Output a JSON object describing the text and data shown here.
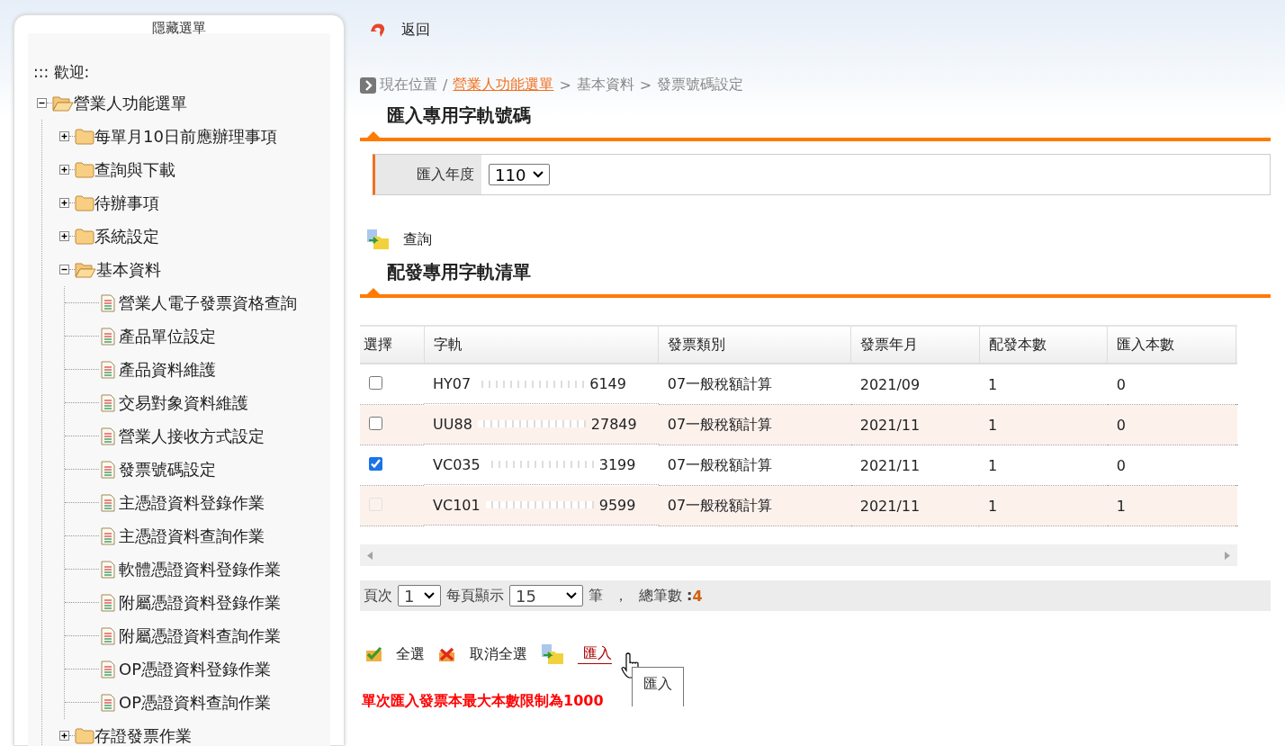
{
  "sidebar": {
    "title": "隱藏選單",
    "welcome": "::: 歡迎:",
    "tree": [
      {
        "kind": "folder",
        "label": "營業人功能選單",
        "expanded": true,
        "children": [
          {
            "kind": "folder",
            "label": "每單月10日前應辦理事項",
            "expanded": false
          },
          {
            "kind": "folder",
            "label": "查詢與下載",
            "expanded": false
          },
          {
            "kind": "folder",
            "label": "待辦事項",
            "expanded": false
          },
          {
            "kind": "folder",
            "label": "系統設定",
            "expanded": false
          },
          {
            "kind": "folder",
            "label": "基本資料",
            "expanded": true,
            "children": [
              {
                "kind": "page",
                "label": "營業人電子發票資格查詢"
              },
              {
                "kind": "page",
                "label": "產品單位設定"
              },
              {
                "kind": "page",
                "label": "產品資料維護"
              },
              {
                "kind": "page",
                "label": "交易對象資料維護"
              },
              {
                "kind": "page",
                "label": "營業人接收方式設定"
              },
              {
                "kind": "page",
                "label": "發票號碼設定"
              },
              {
                "kind": "page",
                "label": "主憑證資料登錄作業"
              },
              {
                "kind": "page",
                "label": "主憑證資料查詢作業"
              },
              {
                "kind": "page",
                "label": "軟體憑證資料登錄作業"
              },
              {
                "kind": "page",
                "label": "附屬憑證資料登錄作業"
              },
              {
                "kind": "page",
                "label": "附屬憑證資料查詢作業"
              },
              {
                "kind": "page",
                "label": "OP憑證資料登錄作業"
              },
              {
                "kind": "page",
                "label": "OP憑證資料查詢作業"
              }
            ]
          },
          {
            "kind": "folder",
            "label": "存證發票作業",
            "expanded": false
          }
        ]
      }
    ]
  },
  "back_link": "返回",
  "breadcrumb": {
    "label": "現在位置",
    "items": [
      {
        "sep": "/",
        "text": "營業人功能選單",
        "kind": "link"
      },
      {
        "sep": ">",
        "text": "基本資料",
        "kind": "text"
      },
      {
        "sep": ">",
        "text": "發票號碼設定",
        "kind": "text"
      }
    ]
  },
  "import_section": {
    "title": "匯入專用字軌號碼",
    "year_label": "匯入年度",
    "year_value": "110",
    "query_button": "查詢"
  },
  "list_section": {
    "title": "配發專用字軌清單",
    "table": {
      "columns": [
        "選擇",
        "字軌",
        "發票類別",
        "發票年月",
        "配發本數",
        "匯入本數"
      ],
      "rows": [
        {
          "checked": false,
          "disabled": false,
          "code_start": "HY07",
          "code_end": "6149",
          "type": "07一般稅額計算",
          "period": "2021/09",
          "issued": "1",
          "imported": "0"
        },
        {
          "checked": false,
          "disabled": false,
          "code_start": "UU88",
          "code_end": "27849",
          "type": "07一般稅額計算",
          "period": "2021/11",
          "issued": "1",
          "imported": "0"
        },
        {
          "checked": true,
          "disabled": false,
          "code_start": "VC035",
          "code_end": "3199",
          "type": "07一般稅額計算",
          "period": "2021/11",
          "issued": "1",
          "imported": "0"
        },
        {
          "checked": false,
          "disabled": true,
          "code_start": "VC101",
          "code_end": "9599",
          "type": "07一般稅額計算",
          "period": "2021/11",
          "issued": "1",
          "imported": "1"
        }
      ]
    }
  },
  "pager": {
    "page_label": "頁次",
    "page": "1",
    "per_page_label": "每頁顯示",
    "per_page": "15",
    "unit": "筆",
    "comma": "，",
    "total_label": "總筆數 **:**",
    "total_value": "4"
  },
  "actions": [
    {
      "kind": "check-all",
      "label": "全選",
      "hovered": false
    },
    {
      "kind": "uncheck-all",
      "label": "取消全選",
      "hovered": false
    },
    {
      "kind": "import",
      "label": "匯入",
      "hovered": true
    }
  ],
  "tooltip": "匯入",
  "note": "單次匯入發票本最大本數限制為1000"
}
